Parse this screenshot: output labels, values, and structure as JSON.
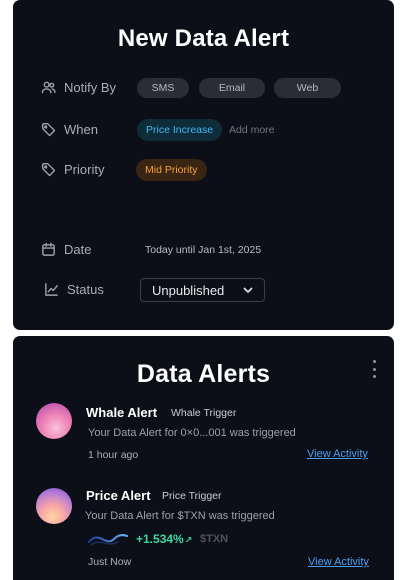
{
  "new_alert": {
    "title": "New Data Alert",
    "notify_by": {
      "label": "Notify By",
      "options": [
        "SMS",
        "Email",
        "Web"
      ]
    },
    "when": {
      "label": "When",
      "tag": "Price Increase",
      "add_more": "Add more"
    },
    "priority": {
      "label": "Priority",
      "tag": "Mid Priority"
    },
    "date": {
      "label": "Date",
      "value": "Today until Jan 1st, 2025"
    },
    "status": {
      "label": "Status",
      "selected": "Unpublished"
    }
  },
  "data_alerts": {
    "title": "Data Alerts",
    "items": [
      {
        "name": "Whale Alert",
        "trigger": "Whale Trigger",
        "description": "Your Data Alert for 0×0...001 was triggered",
        "time": "1 hour ago",
        "action": "View Activity"
      },
      {
        "name": "Price Alert",
        "trigger": "Price Trigger",
        "description": "Your Data Alert for $TXN was triggered",
        "change": "+1.534%",
        "ticker": "$TXN",
        "time": "Just Now",
        "action": "View Activity"
      }
    ]
  },
  "colors": {
    "panel_bg": "#0c0f17",
    "tag_blue": "#41b8f0",
    "tag_orange": "#f2a13a",
    "link": "#4a9ef0",
    "positive": "#3fd8a0"
  },
  "icons": {
    "notify_by": "users-icon",
    "when": "tag-icon",
    "priority": "tag-icon",
    "date": "calendar-icon",
    "status": "chart-line-icon",
    "status_select": "chevron-down-icon",
    "menu": "kebab-menu-icon"
  }
}
